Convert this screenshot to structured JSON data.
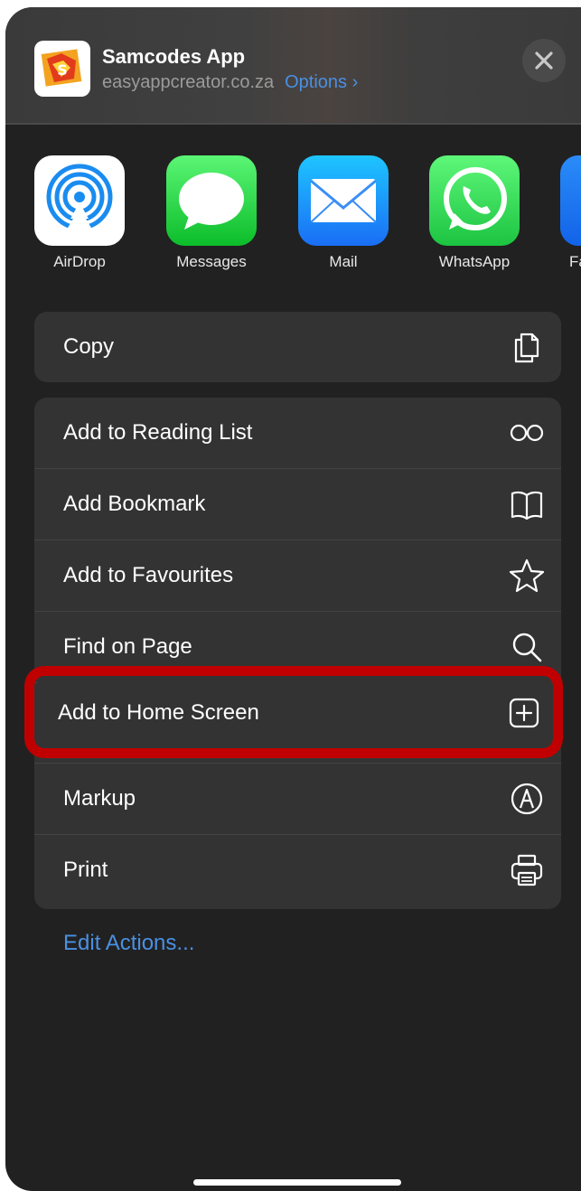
{
  "header": {
    "app_name": "Samcodes App",
    "domain": "easyappcreator.co.za",
    "options_label": "Options ›"
  },
  "share_apps": [
    {
      "label": "AirDrop",
      "icon": "airdrop-icon"
    },
    {
      "label": "Messages",
      "icon": "messages-icon"
    },
    {
      "label": "Mail",
      "icon": "mail-icon"
    },
    {
      "label": "WhatsApp",
      "icon": "whatsapp-icon"
    },
    {
      "label": "Fa",
      "icon": "facebook-icon"
    }
  ],
  "actions": {
    "copy": {
      "label": "Copy",
      "icon": "copy-icon"
    },
    "reading_list": {
      "label": "Add to Reading List",
      "icon": "glasses-icon"
    },
    "bookmark": {
      "label": "Add Bookmark",
      "icon": "book-icon"
    },
    "favourites": {
      "label": "Add to Favourites",
      "icon": "star-icon"
    },
    "find": {
      "label": "Find on Page",
      "icon": "search-icon"
    },
    "home_screen": {
      "label": "Add to Home Screen",
      "icon": "plus-square-icon"
    },
    "markup": {
      "label": "Markup",
      "icon": "markup-icon"
    },
    "print": {
      "label": "Print",
      "icon": "printer-icon"
    }
  },
  "edit_actions_label": "Edit Actions...",
  "colors": {
    "accent": "#4a90e2",
    "highlight": "#c00000",
    "sheet_bg": "#212121",
    "row_bg": "#333333"
  }
}
